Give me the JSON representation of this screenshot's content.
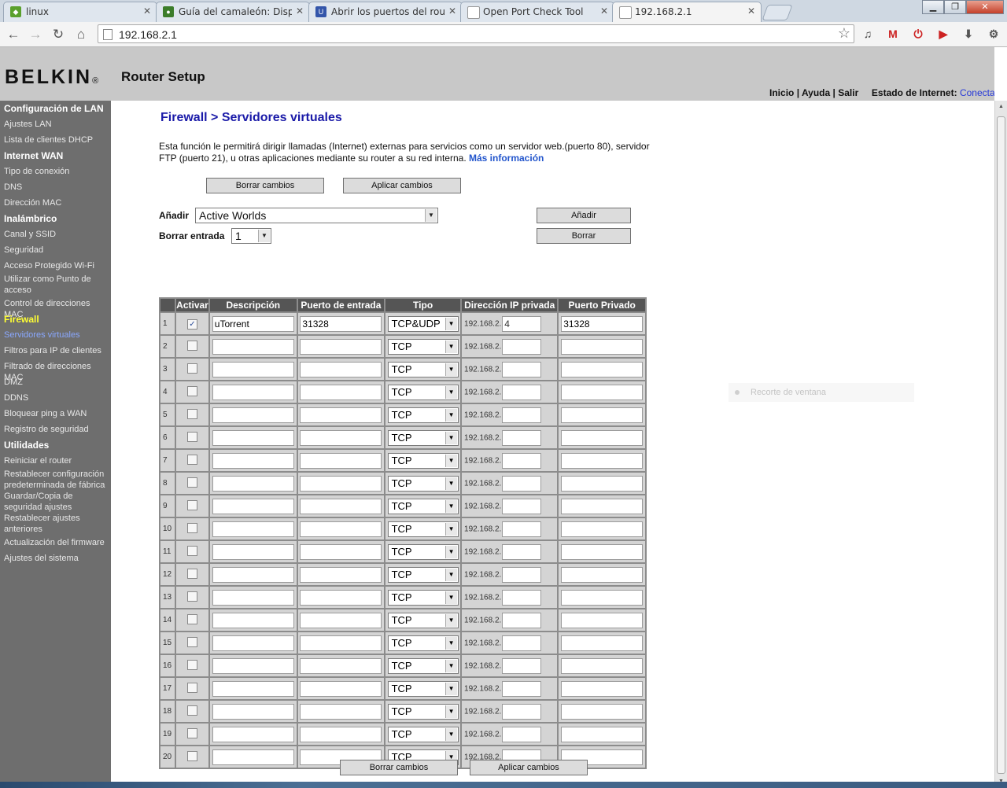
{
  "browser": {
    "tabs": [
      {
        "title": "linux",
        "color": "#5aa02c"
      },
      {
        "title": "Guía del camaleón: Dispon",
        "color": "#3c7d2a"
      },
      {
        "title": "Abrir los puertos del route",
        "color": "#3355aa"
      },
      {
        "title": "Open Port Check Tool",
        "color": "#999999"
      },
      {
        "title": "192.168.2.1",
        "color": "#999999"
      }
    ],
    "url": "192.168.2.1"
  },
  "header": {
    "logo": "BELKIN",
    "logo_mark": "®",
    "title": "Router Setup",
    "links": {
      "home": "Inicio",
      "help": "Ayuda",
      "logout": "Salir",
      "sep": "|"
    },
    "status_label": "Estado de Internet:",
    "status_value": "Conectado"
  },
  "sidebar": {
    "sections": [
      {
        "title": "Configuración de LAN",
        "items": [
          "Ajustes LAN",
          "Lista de clientes DHCP"
        ]
      },
      {
        "title": "Internet WAN",
        "items": [
          "Tipo de conexión",
          "DNS",
          "Dirección MAC"
        ]
      },
      {
        "title": "Inalámbrico",
        "items": [
          "Canal y SSID",
          "Seguridad",
          "Acceso Protegido Wi-Fi",
          "Utilizar como Punto de acceso",
          "Control de direcciones MAC"
        ]
      },
      {
        "title": "Firewall",
        "items": [
          "Servidores virtuales",
          "Filtros para IP de clientes",
          "Filtrado de direcciones MAC",
          "DMZ",
          "DDNS",
          "Bloquear ping a WAN",
          "Registro de seguridad"
        ]
      },
      {
        "title": "Utilidades",
        "items": [
          "Reiniciar el router",
          "Restablecer configuración predeterminada de fábrica",
          "Guardar/Copia de seguridad ajustes",
          "Restablecer ajustes anteriores",
          "Actualización del firmware",
          "Ajustes del sistema"
        ]
      }
    ]
  },
  "main": {
    "title": "Firewall > Servidores virtuales",
    "description": "Esta función le permitirá dirigir llamadas (Internet) externas para servicios como un servidor web.(puerto 80), servidor FTP (puerto 21), u otras aplicaciones mediante su router a su red interna.",
    "more_info": "Más información",
    "clear_label": "Borrar cambios",
    "apply_label": "Aplicar cambios",
    "add_label": "Añadir",
    "add_value": "Active Worlds",
    "add_button": "Añadir",
    "delete_label": "Borrar entrada",
    "delete_value": "1",
    "delete_button": "Borrar",
    "table": {
      "headers": [
        "Activar",
        "Descripción",
        "Puerto de entrada",
        "Tipo",
        "Dirección IP privada",
        "Puerto Privado"
      ],
      "ip_prefix": "192.168.2.",
      "rows": [
        {
          "n": "1",
          "on": true,
          "desc": "uTorrent",
          "port_in": "31328",
          "type": "TCP&UDP",
          "ip": "4",
          "port_priv": "31328"
        },
        {
          "n": "2",
          "on": false,
          "desc": "",
          "port_in": "",
          "type": "TCP",
          "ip": "",
          "port_priv": ""
        },
        {
          "n": "3",
          "on": false,
          "desc": "",
          "port_in": "",
          "type": "TCP",
          "ip": "",
          "port_priv": ""
        },
        {
          "n": "4",
          "on": false,
          "desc": "",
          "port_in": "",
          "type": "TCP",
          "ip": "",
          "port_priv": ""
        },
        {
          "n": "5",
          "on": false,
          "desc": "",
          "port_in": "",
          "type": "TCP",
          "ip": "",
          "port_priv": ""
        },
        {
          "n": "6",
          "on": false,
          "desc": "",
          "port_in": "",
          "type": "TCP",
          "ip": "",
          "port_priv": ""
        },
        {
          "n": "7",
          "on": false,
          "desc": "",
          "port_in": "",
          "type": "TCP",
          "ip": "",
          "port_priv": ""
        },
        {
          "n": "8",
          "on": false,
          "desc": "",
          "port_in": "",
          "type": "TCP",
          "ip": "",
          "port_priv": ""
        },
        {
          "n": "9",
          "on": false,
          "desc": "",
          "port_in": "",
          "type": "TCP",
          "ip": "",
          "port_priv": ""
        },
        {
          "n": "10",
          "on": false,
          "desc": "",
          "port_in": "",
          "type": "TCP",
          "ip": "",
          "port_priv": ""
        },
        {
          "n": "11",
          "on": false,
          "desc": "",
          "port_in": "",
          "type": "TCP",
          "ip": "",
          "port_priv": ""
        },
        {
          "n": "12",
          "on": false,
          "desc": "",
          "port_in": "",
          "type": "TCP",
          "ip": "",
          "port_priv": ""
        },
        {
          "n": "13",
          "on": false,
          "desc": "",
          "port_in": "",
          "type": "TCP",
          "ip": "",
          "port_priv": ""
        },
        {
          "n": "14",
          "on": false,
          "desc": "",
          "port_in": "",
          "type": "TCP",
          "ip": "",
          "port_priv": ""
        },
        {
          "n": "15",
          "on": false,
          "desc": "",
          "port_in": "",
          "type": "TCP",
          "ip": "",
          "port_priv": ""
        },
        {
          "n": "16",
          "on": false,
          "desc": "",
          "port_in": "",
          "type": "TCP",
          "ip": "",
          "port_priv": ""
        },
        {
          "n": "17",
          "on": false,
          "desc": "",
          "port_in": "",
          "type": "TCP",
          "ip": "",
          "port_priv": ""
        },
        {
          "n": "18",
          "on": false,
          "desc": "",
          "port_in": "",
          "type": "TCP",
          "ip": "",
          "port_priv": ""
        },
        {
          "n": "19",
          "on": false,
          "desc": "",
          "port_in": "",
          "type": "TCP",
          "ip": "",
          "port_priv": ""
        },
        {
          "n": "20",
          "on": false,
          "desc": "",
          "port_in": "",
          "type": "TCP",
          "ip": "",
          "port_priv": ""
        }
      ]
    }
  },
  "overlay": {
    "clip_label": "Recorte de ventana"
  }
}
